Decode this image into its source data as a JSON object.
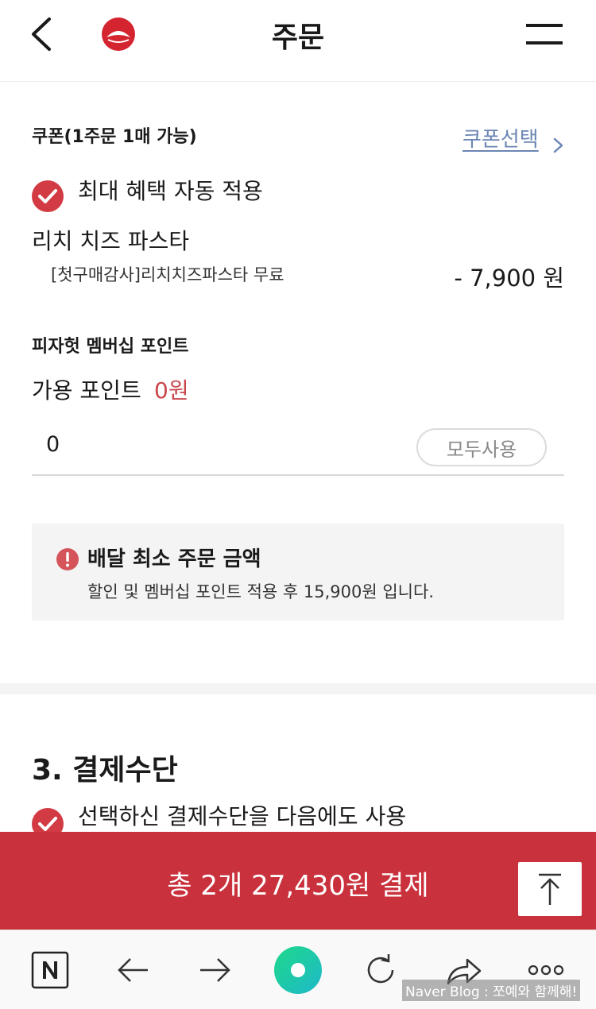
{
  "header": {
    "title": "주문",
    "back_icon": "chevron-left-icon",
    "logo_icon": "pizza-hut-logo",
    "menu_icon": "hamburger-menu-icon"
  },
  "coupon": {
    "heading": "쿠폰(1주문 1매 가능)",
    "select_link": "쿠폰선택",
    "auto_apply_label": "최대 혜택 자동 적용",
    "auto_apply_checked": true,
    "product_name": "리치 치즈 파스타",
    "coupon_description": "[첫구매감사]리치치즈파스타 무료",
    "discount": "- 7,900 원"
  },
  "points": {
    "heading": "피자헛 멤버십 포인트",
    "available_label": "가용 포인트",
    "available_value": "0원",
    "input_value": "0",
    "use_all_label": "모두사용"
  },
  "notice": {
    "title": "배달 최소 주문 금액",
    "description": "할인 및 멤버십 포인트 적용 후 15,900원 입니다."
  },
  "payment": {
    "section_title": "3. 결제수단",
    "save_method_label": "선택하신 결제수단을 다음에도 사용",
    "save_method_checked": true
  },
  "pay_bar": {
    "label": "총 2개 27,430원 결제"
  },
  "browser_toolbar": {
    "items": [
      "naver-n-icon",
      "back-arrow-icon",
      "forward-arrow-icon",
      "green-dot-icon",
      "refresh-icon",
      "share-icon",
      "more-icon"
    ],
    "watermark": "Naver Blog : 쪼예와 함께해!"
  },
  "colors": {
    "accent_red": "#c9313c",
    "check_red": "#d23b43",
    "link_blue": "#6b86b4",
    "points_red": "#c9474c"
  }
}
